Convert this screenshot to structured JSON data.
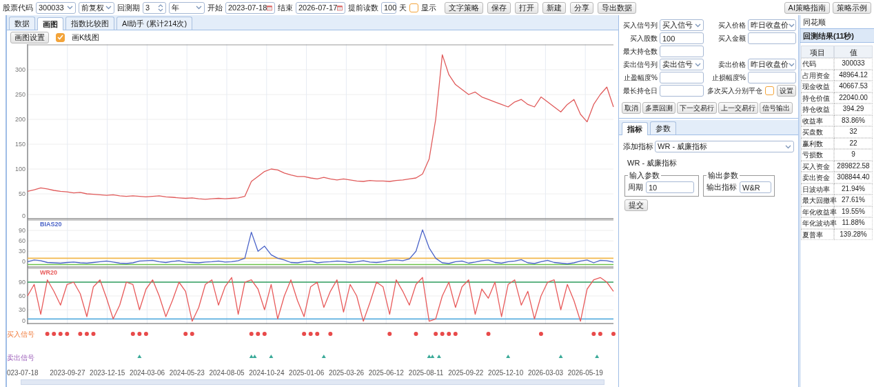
{
  "toolbar": {
    "fields": [
      {
        "kind": "select",
        "label": "股票代码",
        "value": "300033"
      },
      {
        "kind": "select",
        "value": "前复权"
      },
      {
        "kind": "spinner",
        "label": "回测期",
        "value": "3"
      },
      {
        "kind": "select",
        "value": "年"
      },
      {
        "kind": "date",
        "label": "开始",
        "value": "2023-07-18"
      },
      {
        "kind": "date",
        "label": "结束",
        "value": "2026-07-17"
      },
      {
        "kind": "input",
        "label": "提前读数",
        "value": "100",
        "suffix": "天"
      },
      {
        "kind": "checkbox",
        "label": "显示",
        "checked": false
      }
    ],
    "buttons": [
      "文字策略",
      "保存",
      "打开",
      "新建",
      "分享",
      "导出数据"
    ],
    "right_buttons": [
      "AI策略指南",
      "策略示例"
    ]
  },
  "tabs": [
    {
      "label": "数据",
      "selected": false
    },
    {
      "label": "画图",
      "selected": true
    },
    {
      "label": "指数比较图",
      "selected": false
    },
    {
      "label": "AI助手 (累计214次)",
      "selected": false
    }
  ],
  "chart_settings_button": "画图设置",
  "kline_checkbox": {
    "label": "画K线图",
    "checked": true
  },
  "price_chart": {
    "chart_data": {
      "type": "line",
      "grid": true,
      "ylim": [
        0,
        350
      ],
      "yticks": [
        0,
        50,
        100,
        150,
        200,
        250,
        300
      ],
      "series": [
        {
          "color": "#e05a5a",
          "values": [
            55,
            58,
            62,
            60,
            57,
            55,
            54,
            52,
            53,
            50,
            49,
            48,
            47,
            48,
            46,
            45,
            46,
            45,
            44,
            45,
            46,
            44,
            43,
            42,
            41,
            42,
            40,
            39,
            40,
            41,
            40,
            41,
            42,
            45,
            75,
            85,
            95,
            100,
            98,
            92,
            88,
            85,
            85,
            82,
            80,
            83,
            80,
            78,
            80,
            78,
            76,
            75,
            77,
            76,
            76,
            75,
            77,
            78,
            80,
            82,
            90,
            120,
            200,
            330,
            290,
            270,
            260,
            250,
            255,
            245,
            240,
            235,
            230,
            225,
            235,
            240,
            230,
            225,
            245,
            235,
            225,
            215,
            230,
            240,
            210,
            195,
            230,
            250,
            265,
            225
          ]
        }
      ]
    }
  },
  "bias_chart": {
    "chart_data": {
      "type": "line",
      "grid": true,
      "ylim": [
        -15,
        120
      ],
      "yticks": [
        0,
        30,
        60,
        90
      ],
      "series": [
        {
          "name": "BIAS20",
          "color": "#4a63c8",
          "values": [
            0,
            5,
            3,
            -2,
            -3,
            -4,
            -2,
            -1,
            -3,
            -4,
            -2,
            0,
            2,
            -1,
            -4,
            -5,
            -3,
            2,
            3,
            4,
            0,
            -2,
            1,
            3,
            -1,
            -2,
            -3,
            -1,
            0,
            2,
            -1,
            0,
            3,
            10,
            85,
            30,
            45,
            20,
            10,
            5,
            -2,
            -3,
            0,
            2,
            -3,
            -1,
            0,
            2,
            1,
            -2,
            0,
            3,
            -1,
            -2,
            0,
            4,
            5,
            3,
            8,
            30,
            92,
            40,
            10,
            -3,
            -5,
            0,
            2,
            -4,
            -1,
            3,
            5,
            -2,
            -4,
            0,
            2,
            6,
            -3,
            -5,
            0,
            4,
            -2,
            -4,
            -6,
            -3,
            2,
            5,
            -3,
            4,
            3,
            -1
          ]
        }
      ],
      "ref_lines": [
        {
          "axis": "y",
          "value": 10,
          "color": "#f2b84b"
        },
        {
          "axis": "y",
          "value": -8,
          "color": "#6cc24a"
        }
      ]
    }
  },
  "wr_chart": {
    "chart_data": {
      "type": "line",
      "grid": true,
      "ylim": [
        0,
        120
      ],
      "yticks": [
        0,
        30,
        60,
        90
      ],
      "series": [
        {
          "name": "WR20",
          "color": "#e85a5a",
          "values": [
            60,
            85,
            20,
            95,
            70,
            40,
            85,
            90,
            65,
            15,
            80,
            95,
            55,
            10,
            40,
            90,
            85,
            30,
            75,
            95,
            60,
            15,
            50,
            90,
            70,
            5,
            35,
            85,
            95,
            40,
            80,
            100,
            20,
            90,
            95,
            75,
            30,
            85,
            10,
            60,
            95,
            50,
            15,
            80,
            90,
            35,
            70,
            95,
            25,
            85,
            60,
            5,
            45,
            90,
            80,
            20,
            95,
            70,
            40,
            85,
            100,
            5,
            10,
            60,
            90,
            35,
            80,
            95,
            20,
            75,
            55,
            90,
            15,
            85,
            95,
            40,
            70,
            10,
            60,
            90,
            95,
            30,
            85,
            50,
            5,
            75,
            95,
            100,
            90,
            70
          ]
        }
      ],
      "ref_lines": [
        {
          "axis": "y",
          "value": 90,
          "color": "#2e9e5e"
        },
        {
          "axis": "y",
          "value": 10,
          "color": "#5aaee0"
        }
      ]
    }
  },
  "signals": [
    {
      "label": "买入信号",
      "kind": "buy"
    },
    {
      "label": "卖出信号",
      "kind": "sell"
    }
  ],
  "date_axis": [
    "023-07-18",
    "2023-09-27",
    "2023-12-15",
    "2024-03-06",
    "2024-05-23",
    "2024-08-05",
    "2024-10-24",
    "2025-01-06",
    "2025-03-26",
    "2025-06-12",
    "2025-08-11",
    "2025-09-22",
    "2025-12-10",
    "2026-03-03",
    "2026-05-19"
  ],
  "trade_form": {
    "rows": [
      [
        {
          "kind": "select",
          "label": "买入信号列",
          "value": "买入信号"
        },
        {
          "kind": "select",
          "label": "买入价格",
          "value": "昨日收盘价"
        }
      ],
      [
        {
          "kind": "input",
          "label": "买入股数",
          "value": "100"
        },
        {
          "kind": "input",
          "label": "买入金额"
        }
      ],
      [
        {
          "kind": "input",
          "label": "最大持仓数"
        }
      ],
      [
        {
          "kind": "select",
          "label": "卖出信号列",
          "value": "卖出信号"
        },
        {
          "kind": "select",
          "label": "卖出价格",
          "value": "昨日收盘价"
        }
      ],
      [
        {
          "kind": "input",
          "label": "止盈幅度%"
        },
        {
          "kind": "input",
          "label": "止损幅度%"
        }
      ],
      [
        {
          "kind": "input",
          "label": "最长持仓日"
        },
        {
          "kind": "checkbox",
          "label": "多次买入分别平仓",
          "checked": false,
          "button": "设置"
        }
      ]
    ],
    "buttons": [
      "取消",
      "多票回测",
      "下一交易行",
      "上一交易行",
      "信号输出"
    ]
  },
  "sub_tabs": [
    {
      "label": "指标",
      "selected": true
    },
    {
      "label": "参数",
      "selected": false
    }
  ],
  "indicator": {
    "label": "添加指标",
    "value": "WR - 威廉指标",
    "heading": "WR - 威廉指标",
    "input_group": {
      "title": "输入参数",
      "label": "周期",
      "value": "10"
    },
    "output_group": {
      "title": "输出参数",
      "label": "输出指标",
      "value": "W&R"
    },
    "submit": "提交"
  },
  "results": {
    "source": "同花顺",
    "title": "回测结果(11秒)",
    "columns": [
      "项目",
      "值"
    ],
    "rows": [
      [
        "代码",
        "300033"
      ],
      [
        "占用资金",
        "48964.12"
      ],
      [
        "现金收益",
        "40667.53"
      ],
      [
        "持仓价值",
        "22040.00"
      ],
      [
        "持仓收益",
        "394.29"
      ],
      [
        "收益率",
        "83.86%"
      ],
      [
        "买盘数",
        "32"
      ],
      [
        "赢利数",
        "22"
      ],
      [
        "亏损数",
        "9"
      ],
      [
        "买入资金",
        "289822.58"
      ],
      [
        "卖出资金",
        "308844.40"
      ],
      [
        "日波动率",
        "21.94%"
      ],
      [
        "最大回撤率",
        "27.61%"
      ],
      [
        "年化收益率",
        "19.55%"
      ],
      [
        "年化波动率",
        "11.88%"
      ],
      [
        "夏普率",
        "139.28%"
      ]
    ]
  }
}
